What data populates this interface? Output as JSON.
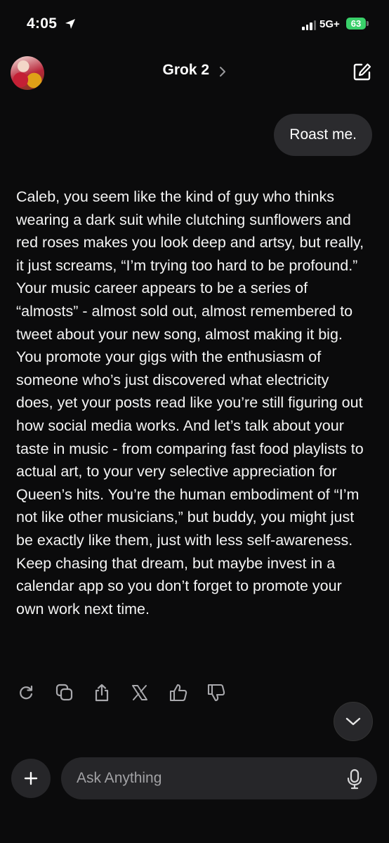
{
  "status_bar": {
    "time": "4:05",
    "network": "5G+",
    "battery": "63"
  },
  "header": {
    "title": "Grok 2"
  },
  "conversation": {
    "user_message": "Roast me.",
    "assistant_message": "Caleb, you seem like the kind of guy who thinks wearing a dark suit while clutching sunflowers and red roses makes you look deep and artsy, but really, it just screams, “I’m trying too hard to be profound.” Your music career appears to be a series of “almosts” - almost sold out, almost remembered to tweet about your new song, almost making it big. You promote your gigs with the enthusiasm of someone who’s just discovered what electricity does, yet your posts read like you’re still figuring out how social media works. And let’s talk about your taste in music - from comparing fast food playlists to actual art, to your very selective appreciation for Queen’s hits. You’re the human embodiment of “I’m not like other musicians,” but buddy, you might just be exactly like them, just with less self-awareness. Keep chasing that dream, but maybe invest in a calendar app so you don’t forget to promote your own work next time."
  },
  "message_actions": [
    {
      "icon": "regenerate-icon"
    },
    {
      "icon": "copy-icon"
    },
    {
      "icon": "share-icon"
    },
    {
      "icon": "x-logo-icon"
    },
    {
      "icon": "thumbs-up-icon"
    },
    {
      "icon": "thumbs-down-icon"
    }
  ],
  "composer": {
    "placeholder": "Ask Anything"
  },
  "colors": {
    "background": "#0b0b0c",
    "bubble": "#2b2b2e",
    "input": "#262629",
    "battery": "#3ad06a"
  }
}
